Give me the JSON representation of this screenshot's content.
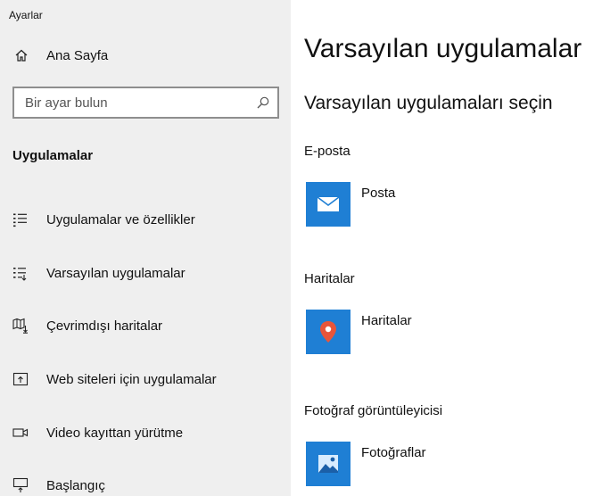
{
  "window": {
    "title": "Ayarlar"
  },
  "sidebar": {
    "home_label": "Ana Sayfa",
    "search_placeholder": "Bir ayar bulun",
    "section_title": "Uygulamalar",
    "items": [
      {
        "label": "Uygulamalar ve özellikler",
        "icon": "apps-features-icon"
      },
      {
        "label": "Varsayılan uygulamalar",
        "icon": "default-apps-icon"
      },
      {
        "label": "Çevrimdışı haritalar",
        "icon": "offline-maps-icon"
      },
      {
        "label": "Web siteleri için uygulamalar",
        "icon": "apps-for-websites-icon"
      },
      {
        "label": "Video kayıttan yürütme",
        "icon": "video-playback-icon"
      },
      {
        "label": "Başlangıç",
        "icon": "startup-icon"
      }
    ]
  },
  "main": {
    "title": "Varsayılan uygulamalar",
    "subtitle": "Varsayılan uygulamaları seçin",
    "categories": [
      {
        "label": "E-posta",
        "app": "Posta",
        "icon": "mail-icon"
      },
      {
        "label": "Haritalar",
        "app": "Haritalar",
        "icon": "maps-pin-icon"
      },
      {
        "label": "Fotoğraf görüntüleyicisi",
        "app": "Fotoğraflar",
        "icon": "photos-icon"
      }
    ]
  },
  "colors": {
    "accent": "#1f7fd4",
    "sidebar_bg": "#efefef",
    "map_pin": "#e8553a"
  }
}
